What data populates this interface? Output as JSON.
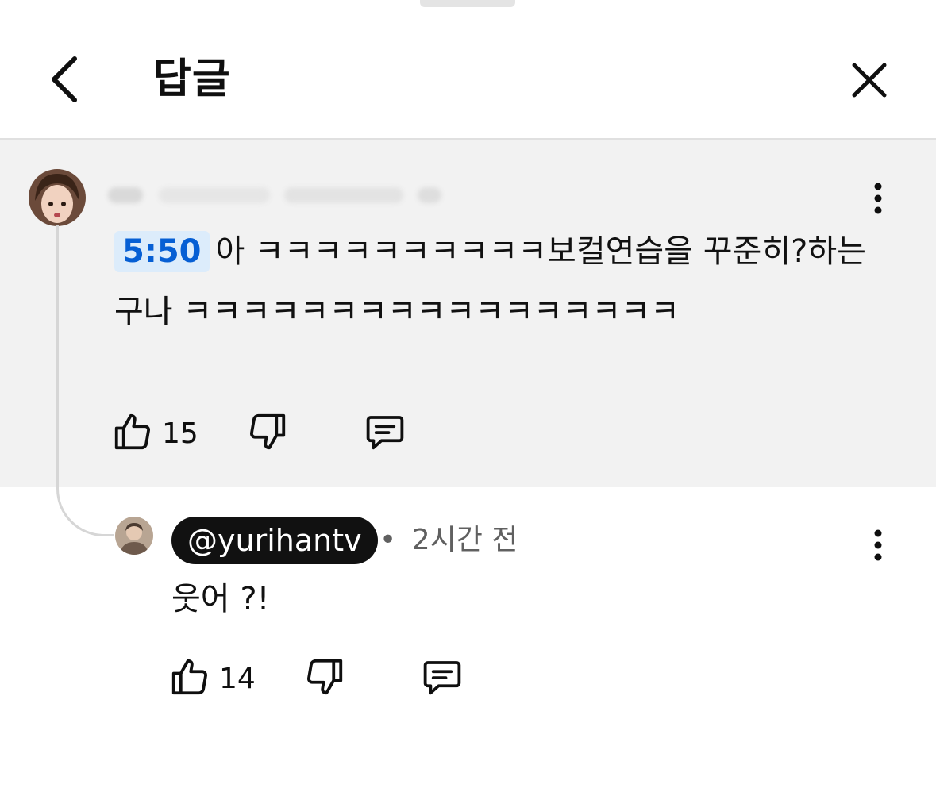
{
  "header": {
    "title": "답글",
    "back_icon": "chevron-left-icon",
    "close_icon": "close-icon"
  },
  "parent_comment": {
    "timestamp": "5:50",
    "text": "아 ㅋㅋㅋㅋㅋㅋㅋㅋㅋㅋ보컬연습을 꾸준히?하는구나 ㅋㅋㅋㅋㅋㅋㅋㅋㅋㅋㅋㅋㅋㅋㅋㅋㅋ",
    "likes": "15"
  },
  "reply": {
    "handle": "@yurihantv",
    "time": "2시간 전",
    "separator": "•",
    "text": "웃어 ?!",
    "likes": "14"
  },
  "colors": {
    "timestamp_bg": "#dcecfb",
    "timestamp_fg": "#065fd4",
    "highlight_bg": "#f2f2f2"
  }
}
